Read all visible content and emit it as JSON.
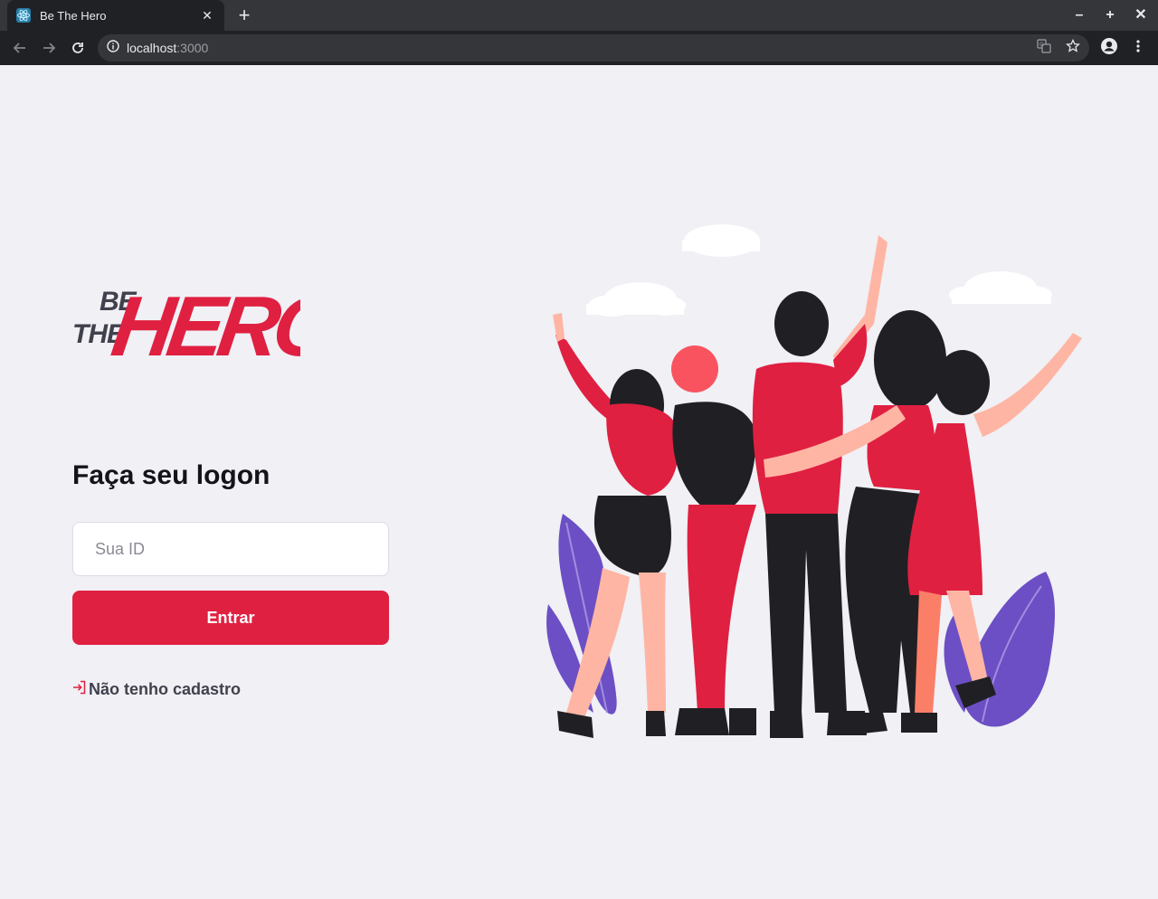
{
  "browser": {
    "tab_title": "Be The Hero",
    "url_host": "localhost",
    "url_port": ":3000",
    "icons": [
      "react-icon",
      "close-icon",
      "new-tab-icon",
      "minimize-icon",
      "maximize-icon",
      "window-close-icon",
      "back-icon",
      "forward-icon",
      "reload-icon",
      "info-icon",
      "translate-icon",
      "star-icon",
      "account-icon",
      "menu-icon"
    ]
  },
  "logo": {
    "line1": "BE",
    "line2": "THE",
    "word": "HERO"
  },
  "logon": {
    "title": "Faça seu logon",
    "id_placeholder": "Sua ID",
    "id_value": "",
    "submit_label": "Entrar",
    "register_link": "Não tenho cadastro"
  },
  "colors": {
    "brand_red": "#e02041",
    "background": "#f0f0f5",
    "heading": "#13131a",
    "link_text": "#41414d"
  }
}
